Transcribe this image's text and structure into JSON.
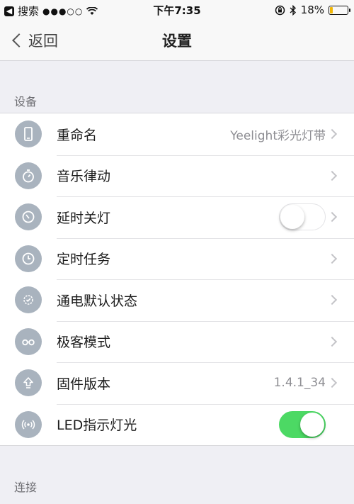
{
  "status_bar": {
    "back_app": "搜索",
    "signal": "●●●○○",
    "time": "下午7:35",
    "battery": "18%",
    "battery_level": 0.18
  },
  "nav": {
    "back_label": "返回",
    "title": "设置"
  },
  "sections": {
    "device": "设备",
    "connection": "连接"
  },
  "rows": [
    {
      "label": "重命名",
      "value": "Yeelight彩光灯带",
      "icon": "phone-icon",
      "control": "chevron"
    },
    {
      "label": "音乐律动",
      "value": "",
      "icon": "stopwatch-icon",
      "control": "chevron"
    },
    {
      "label": "延时关灯",
      "value": "",
      "icon": "timer-off-icon",
      "control": "toggle-off"
    },
    {
      "label": "定时任务",
      "value": "",
      "icon": "clock-icon",
      "control": "chevron"
    },
    {
      "label": "通电默认状态",
      "value": "",
      "icon": "power-default-icon",
      "control": "chevron"
    },
    {
      "label": "极客模式",
      "value": "",
      "icon": "glasses-icon",
      "control": "chevron"
    },
    {
      "label": "固件版本",
      "value": "1.4.1_34",
      "icon": "upgrade-arrow-icon",
      "control": "chevron"
    },
    {
      "label": "LED指示灯光",
      "value": "",
      "icon": "signal-waves-icon",
      "control": "toggle-on"
    }
  ],
  "colors": {
    "icon_bg": "#a9b3be",
    "toggle_on": "#4cd964",
    "battery_fill": "#f2b705"
  }
}
